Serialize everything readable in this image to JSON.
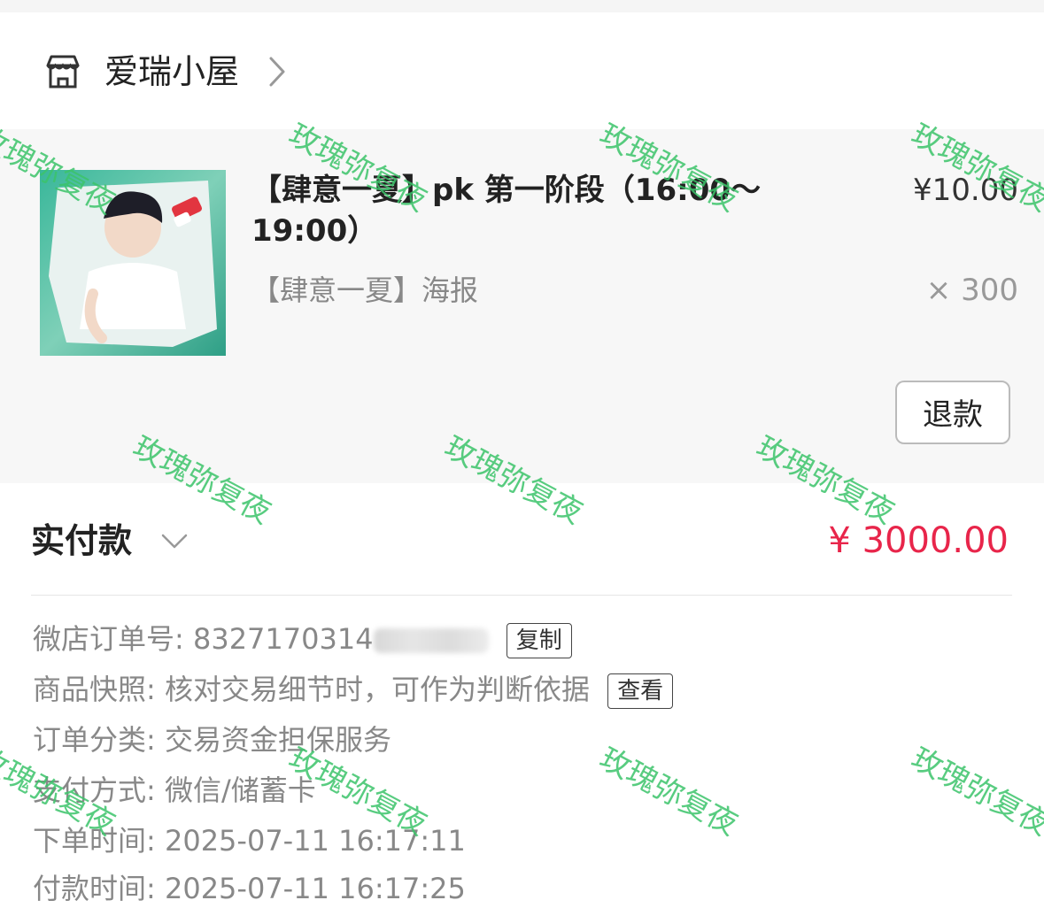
{
  "shop": {
    "name": "爱瑞小屋",
    "icon": "store-icon"
  },
  "item": {
    "title": "【肆意一夏】pk 第一阶段（16:00～19:00）",
    "price": "¥10.00",
    "sku": "【肆意一夏】海报",
    "quantity": "× 300",
    "refund_label": "退款"
  },
  "payment": {
    "label": "实付款",
    "amount": "¥ 3000.00",
    "amount_color": "#e8254a"
  },
  "order_info": {
    "order_no_label": "微店订单号:",
    "order_no_value": "8327170314",
    "copy_label": "复制",
    "snapshot_label": "商品快照:",
    "snapshot_value": "核对交易细节时，可作为判断依据",
    "view_label": "查看",
    "category_label": "订单分类:",
    "category_value": "交易资金担保服务",
    "pay_method_label": "支付方式:",
    "pay_method_value": "微信/储蓄卡",
    "order_time_label": "下单时间:",
    "order_time_value": "2025-07-11 16:17:11",
    "pay_time_label": "付款时间:",
    "pay_time_value": "2025-07-11 16:17:25"
  },
  "watermark": {
    "text": "玫瑰弥复夜",
    "color": "#3cc46a"
  }
}
